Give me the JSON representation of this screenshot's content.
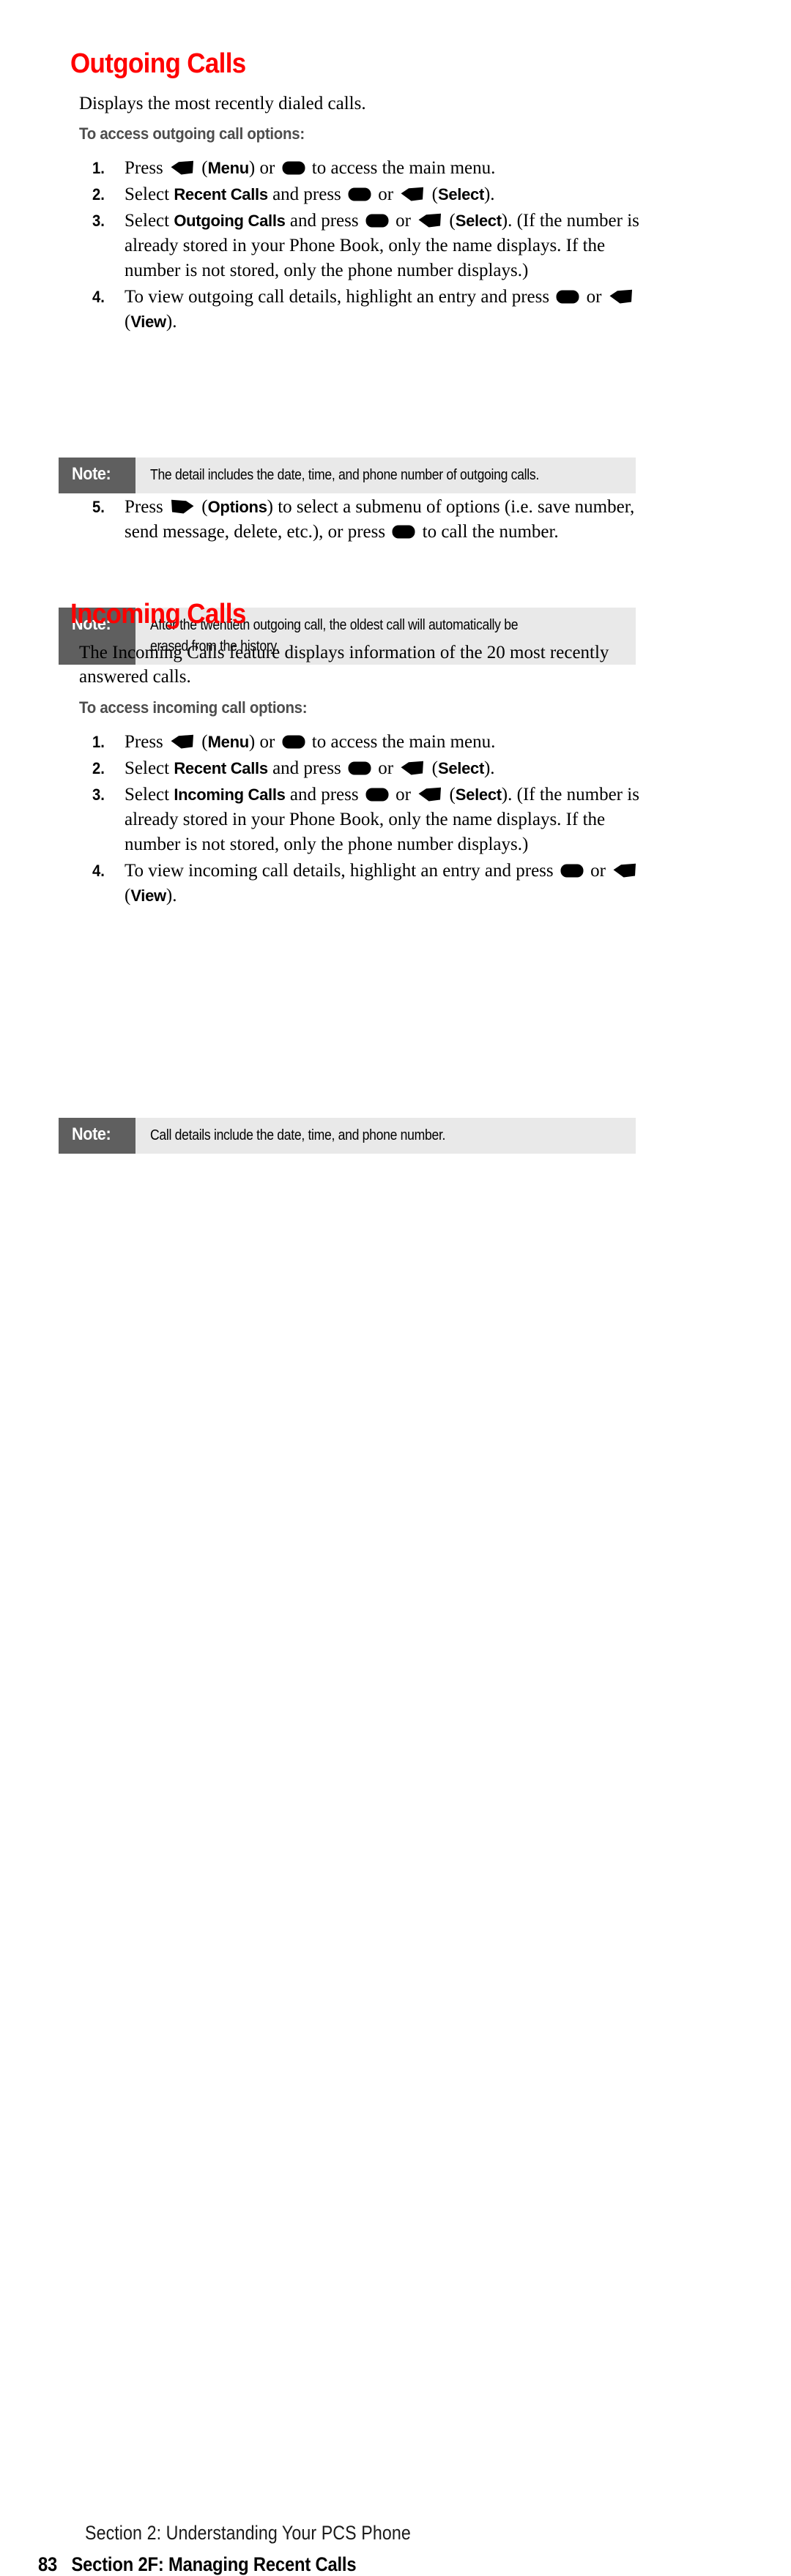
{
  "page": {
    "number": "83",
    "footer_running_head": "Section 2: Understanding Your PCS Phone",
    "footer_section": "Section 2F: Managing Recent Calls"
  },
  "icons": {
    "softkey_left": "left-softkey-icon",
    "softkey_right": "right-softkey-icon",
    "ok_key": "ok-key-icon"
  },
  "sections": [
    {
      "id": "outgoing",
      "heading": "Outgoing Calls",
      "heading_color": "#ff0000",
      "intro": "Displays the most recently dialed calls.",
      "subheading": "To access outgoing call options:",
      "steps": [
        {
          "number": "1.",
          "parts": [
            {
              "t": "text",
              "v": "Press "
            },
            {
              "t": "icon",
              "v": "softkey_left"
            },
            {
              "t": "text",
              "v": " ("
            },
            {
              "t": "bold",
              "v": "Menu"
            },
            {
              "t": "text",
              "v": ") or "
            },
            {
              "t": "icon",
              "v": "ok_key"
            },
            {
              "t": "text",
              "v": " to access the main menu."
            }
          ]
        },
        {
          "number": "2.",
          "parts": [
            {
              "t": "text",
              "v": "Select "
            },
            {
              "t": "bold",
              "v": "Recent Calls"
            },
            {
              "t": "text",
              "v": " and press "
            },
            {
              "t": "icon",
              "v": "ok_key"
            },
            {
              "t": "text",
              "v": " or "
            },
            {
              "t": "icon",
              "v": "softkey_left"
            },
            {
              "t": "text",
              "v": " ("
            },
            {
              "t": "bold",
              "v": "Select"
            },
            {
              "t": "text",
              "v": ")."
            }
          ]
        },
        {
          "number": "3.",
          "parts": [
            {
              "t": "text",
              "v": "Select "
            },
            {
              "t": "bold",
              "v": "Outgoing Calls"
            },
            {
              "t": "text",
              "v": " and press "
            },
            {
              "t": "icon",
              "v": "ok_key"
            },
            {
              "t": "text",
              "v": " or "
            },
            {
              "t": "icon",
              "v": "softkey_left"
            },
            {
              "t": "text",
              "v": " ("
            },
            {
              "t": "bold",
              "v": "Select"
            },
            {
              "t": "text",
              "v": "). (If the number is already stored in your Phone Book, only the name displays. If the number is not stored, only the phone number displays.)"
            }
          ]
        },
        {
          "number": "4.",
          "parts": [
            {
              "t": "text",
              "v": "To view outgoing call details, highlight an entry and press "
            },
            {
              "t": "icon",
              "v": "ok_key"
            },
            {
              "t": "text",
              "v": " or "
            },
            {
              "t": "icon",
              "v": "softkey_left"
            },
            {
              "t": "text",
              "v": " ("
            },
            {
              "t": "bold",
              "v": "View"
            },
            {
              "t": "text",
              "v": ")."
            }
          ]
        },
        {
          "number": "5.",
          "parts": [
            {
              "t": "text",
              "v": "Press "
            },
            {
              "t": "icon",
              "v": "softkey_right"
            },
            {
              "t": "text",
              "v": " ("
            },
            {
              "t": "bold",
              "v": "Options"
            },
            {
              "t": "text",
              "v": ") to select a submenu of options (i.e. save number, send message, delete, etc.), or press "
            },
            {
              "t": "icon",
              "v": "ok_key"
            },
            {
              "t": "text",
              "v": " to call the number."
            }
          ]
        }
      ]
    },
    {
      "id": "incoming",
      "heading": "Incoming Calls",
      "heading_color": "#ff0000",
      "intro": "The Incoming Calls feature displays information of the 20 most recently answered calls.",
      "subheading": "To access incoming call options:",
      "steps": [
        {
          "number": "1.",
          "parts": [
            {
              "t": "text",
              "v": "Press "
            },
            {
              "t": "icon",
              "v": "softkey_left"
            },
            {
              "t": "text",
              "v": " ("
            },
            {
              "t": "bold",
              "v": "Menu"
            },
            {
              "t": "text",
              "v": ") or "
            },
            {
              "t": "icon",
              "v": "ok_key"
            },
            {
              "t": "text",
              "v": " to access the main menu."
            }
          ]
        },
        {
          "number": "2.",
          "parts": [
            {
              "t": "text",
              "v": "Select "
            },
            {
              "t": "bold",
              "v": "Recent Calls"
            },
            {
              "t": "text",
              "v": " and press "
            },
            {
              "t": "icon",
              "v": "ok_key"
            },
            {
              "t": "text",
              "v": " or "
            },
            {
              "t": "icon",
              "v": "softkey_left"
            },
            {
              "t": "text",
              "v": " ("
            },
            {
              "t": "bold",
              "v": "Select"
            },
            {
              "t": "text",
              "v": ")."
            }
          ]
        },
        {
          "number": "3.",
          "parts": [
            {
              "t": "text",
              "v": "Select "
            },
            {
              "t": "bold",
              "v": "Incoming Calls"
            },
            {
              "t": "text",
              "v": " and press "
            },
            {
              "t": "icon",
              "v": "ok_key"
            },
            {
              "t": "text",
              "v": " or "
            },
            {
              "t": "icon",
              "v": "softkey_left"
            },
            {
              "t": "text",
              "v": " ("
            },
            {
              "t": "bold",
              "v": "Select"
            },
            {
              "t": "text",
              "v": "). (If the number is already stored in your Phone Book, only the name displays. If the number is not stored, only the phone number displays.)"
            }
          ]
        },
        {
          "number": "4.",
          "parts": [
            {
              "t": "text",
              "v": "To view incoming call details, highlight an entry and press "
            },
            {
              "t": "icon",
              "v": "ok_key"
            },
            {
              "t": "text",
              "v": " or "
            },
            {
              "t": "icon",
              "v": "softkey_left"
            },
            {
              "t": "text",
              "v": " ("
            },
            {
              "t": "bold",
              "v": "View"
            },
            {
              "t": "text",
              "v": ")."
            }
          ]
        }
      ]
    }
  ],
  "notes": [
    {
      "id": "note-outgoing-detail",
      "label": "Note:",
      "lines": [
        "The detail includes the date, time, and phone number of outgoing calls."
      ]
    },
    {
      "id": "note-outgoing-twentieth",
      "label": "Note:",
      "lines": [
        "After the twentieth outgoing call, the oldest call will automatically be",
        "erased from the history."
      ]
    },
    {
      "id": "note-incoming-detail",
      "label": "Note:",
      "lines": [
        "Call details include the date, time, and phone number."
      ]
    }
  ],
  "colors": {
    "heading_red": "#ff0000",
    "subheading_gray": "#4d4d4d",
    "note_label_bg": "#5f5f5f",
    "note_body_bg": "#e9e9e9"
  }
}
